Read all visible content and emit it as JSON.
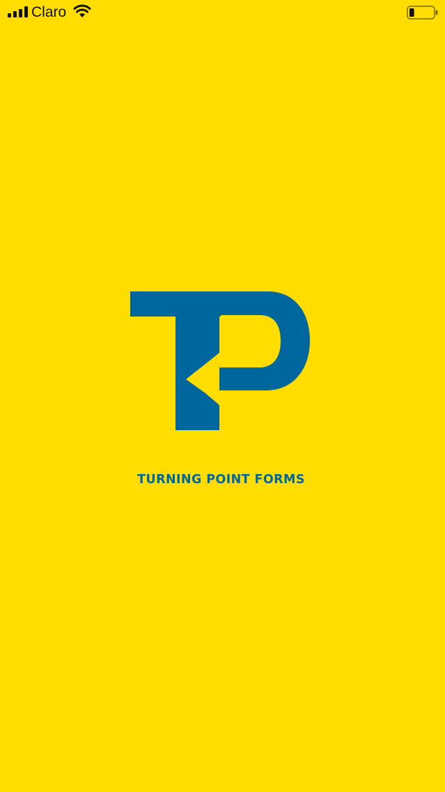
{
  "status_bar": {
    "carrier": "Claro",
    "signal_icon": "cellular-signal-icon",
    "wifi_icon": "wifi-icon",
    "battery_icon": "battery-icon",
    "battery_level": 0.2
  },
  "splash": {
    "logo_icon": "tp-logo-mark",
    "brand_name": "TURNING POINT FORMS"
  },
  "colors": {
    "background": "#FFDD00",
    "brand_blue": "#00679E",
    "status_text": "#111111"
  }
}
